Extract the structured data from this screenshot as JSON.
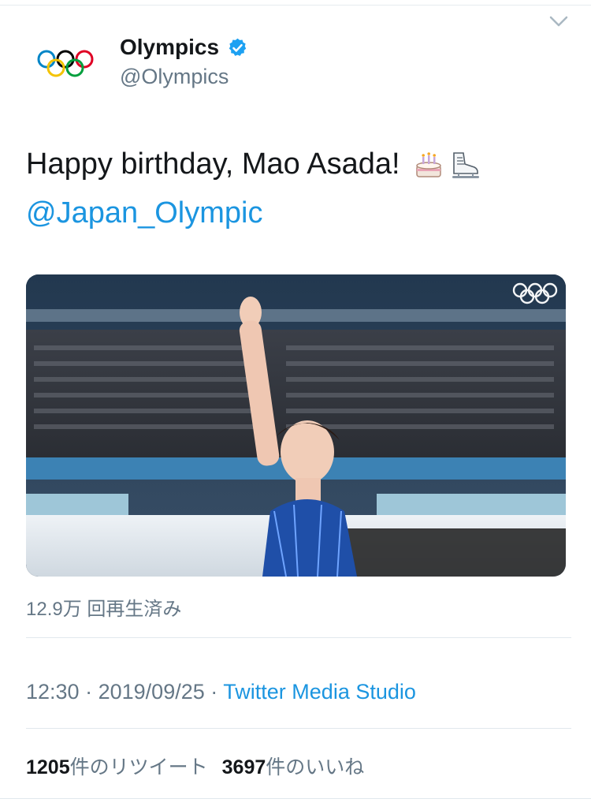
{
  "tweet": {
    "author": {
      "display_name": "Olympics",
      "handle": "@Olympics",
      "verified": true
    },
    "text": "Happy birthday, Mao Asada!",
    "emojis": [
      "birthday-cake",
      "ice-skate"
    ],
    "mention": "@Japan_Olympic",
    "media": {
      "type": "video",
      "description_icon": "olympic-rings-watermark"
    },
    "views": "12.9万 回再生済み",
    "time": "12:30",
    "separator": "·",
    "date": "2019/09/25",
    "source": "Twitter Media Studio",
    "retweets": {
      "count": "1205",
      "label": "件のリツイート"
    },
    "likes": {
      "count": "3697",
      "label": "件のいいね"
    }
  },
  "colors": {
    "link": "#1b95e0",
    "secondary_text": "#657786",
    "verified": "#1da1f2",
    "divider": "#e1e8ed"
  }
}
